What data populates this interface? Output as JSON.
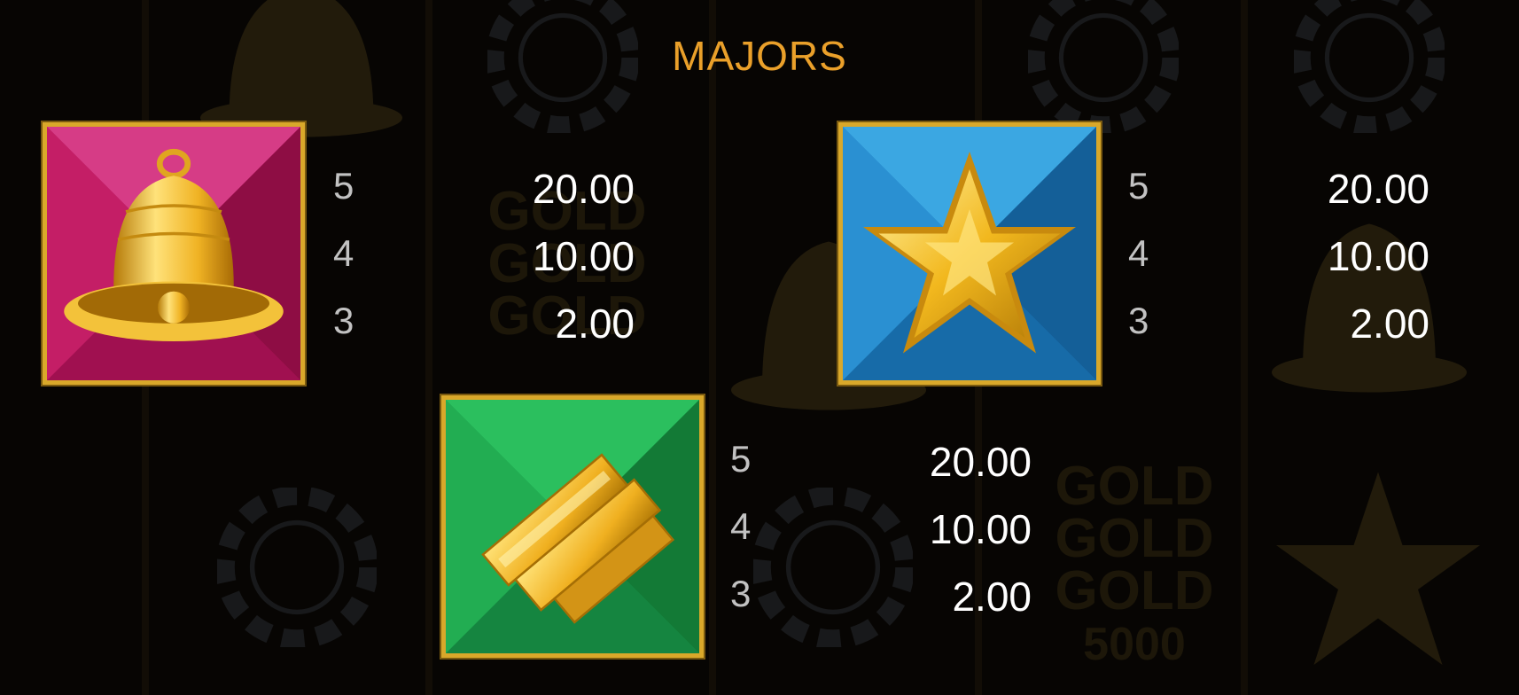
{
  "title": "MAJORS",
  "colors": {
    "title": "#eaa02a",
    "frame": "#d9a82a",
    "count_text": "#c2c2c2",
    "value_text": "#ffffff",
    "bell_tile": "#b5145a",
    "star_tile": "#1f7fc2",
    "gold_tile": "#1c9f4a"
  },
  "symbols": [
    {
      "name": "bell",
      "icon": "bell-icon",
      "payouts": [
        {
          "count": "5",
          "value": "20.00"
        },
        {
          "count": "4",
          "value": "10.00"
        },
        {
          "count": "3",
          "value": "2.00"
        }
      ]
    },
    {
      "name": "star",
      "icon": "star-icon",
      "payouts": [
        {
          "count": "5",
          "value": "20.00"
        },
        {
          "count": "4",
          "value": "10.00"
        },
        {
          "count": "3",
          "value": "2.00"
        }
      ]
    },
    {
      "name": "gold bars",
      "icon": "gold-bars-icon",
      "payouts": [
        {
          "count": "5",
          "value": "20.00"
        },
        {
          "count": "4",
          "value": "10.00"
        },
        {
          "count": "3",
          "value": "2.00"
        }
      ]
    }
  ],
  "background": {
    "gold_text": [
      "GOLD",
      "GOLD",
      "GOLD"
    ],
    "jackpot_value": "5000"
  }
}
